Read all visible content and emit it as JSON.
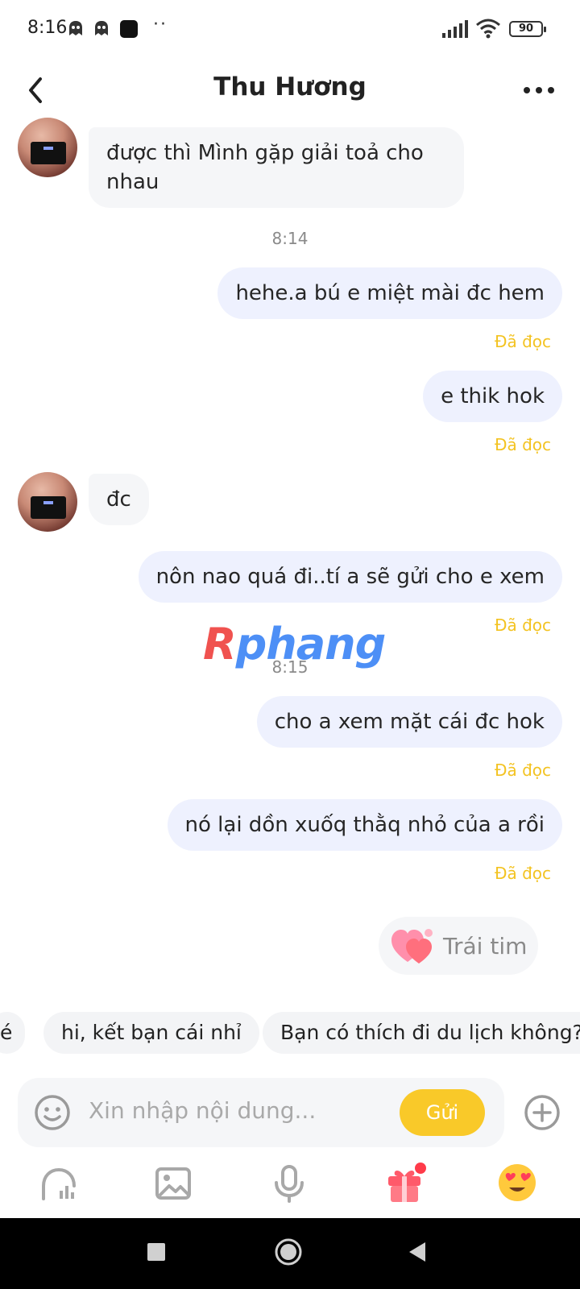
{
  "status_bar": {
    "time": "8:16",
    "battery": "90"
  },
  "header": {
    "title": "Thu Hương"
  },
  "messages": [
    {
      "side": "in",
      "text": "được thì Mình gặp giải toả cho nhau"
    },
    {
      "side": "out",
      "text": "hehe.a bú e miệt mài đc hem",
      "status": "Đã đọc"
    },
    {
      "side": "out",
      "text": "e thik hok",
      "status": "Đã đọc"
    },
    {
      "side": "in",
      "text": "đc"
    },
    {
      "side": "out",
      "text": "nôn nao quá đi..tí a sẽ gửi cho e xem",
      "status": "Đã đọc"
    },
    {
      "side": "out",
      "text": "cho a xem mặt cái đc hok",
      "status": "Đã đọc"
    },
    {
      "side": "out",
      "text": "nó lại dồn xuốq thằq nhỏ của a rồi",
      "status": "Đã đọc"
    }
  ],
  "time_separators": [
    "8:14",
    "8:15"
  ],
  "watermark": {
    "part1": "R",
    "part2": "phang"
  },
  "heart_suggestion": {
    "label": "Trái tim"
  },
  "quick_replies": [
    "é",
    "hi, kết bạn cái nhỉ",
    "Bạn có thích đi du lịch không?"
  ],
  "composer": {
    "placeholder": "Xin nhập nội dung...",
    "send_label": "Gửi"
  },
  "colors": {
    "accent_yellow": "#f9c929",
    "read_status": "#f3c322",
    "outgoing_bubble": "#eef1fe",
    "incoming_bubble": "#f5f6f8"
  },
  "icons": {
    "toolbar": [
      "stats-icon",
      "image-icon",
      "microphone-icon",
      "gift-icon",
      "heart-eyes-emoji-icon"
    ]
  }
}
